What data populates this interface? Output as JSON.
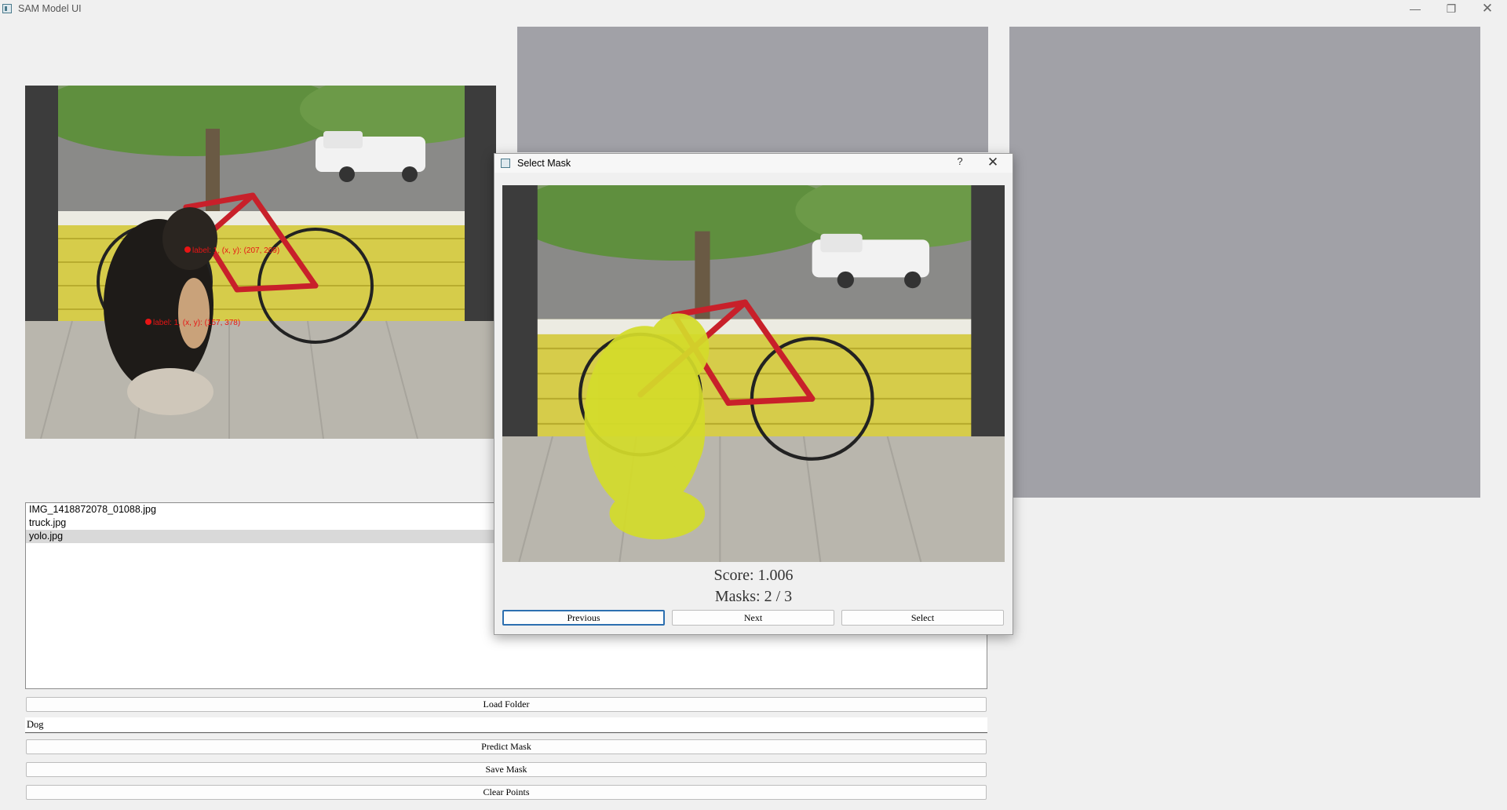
{
  "window": {
    "title": "SAM Model UI",
    "minimize": "—",
    "maximize": "❐",
    "close": "✕"
  },
  "main_image": {
    "point_labels": [
      "label: 1, (x, y): (207, 209)",
      "label: 1, (x, y): (157, 378)"
    ],
    "point_color": "#e81414"
  },
  "files": [
    "IMG_1418872078_01088.jpg",
    "truck.jpg",
    "yolo.jpg"
  ],
  "selected_file": "yolo.jpg",
  "buttons": {
    "load_folder": "Load Folder",
    "predict_mask": "Predict Mask",
    "save_mask": "Save Mask",
    "clear_points": "Clear Points"
  },
  "prompt_input": {
    "value": "Dog"
  },
  "dialog": {
    "title": "Select Mask",
    "help": "?",
    "close": "✕",
    "score": "Score: 1.006",
    "masks": "Masks: 2 / 3",
    "previous": "Previous",
    "next": "Next",
    "select": "Select",
    "mask_color": "#d4dc2a"
  },
  "colors": {
    "panel_gray": "#a1a1a7",
    "selection": "#d9d9d9",
    "focus_border": "#2c6fb0"
  }
}
